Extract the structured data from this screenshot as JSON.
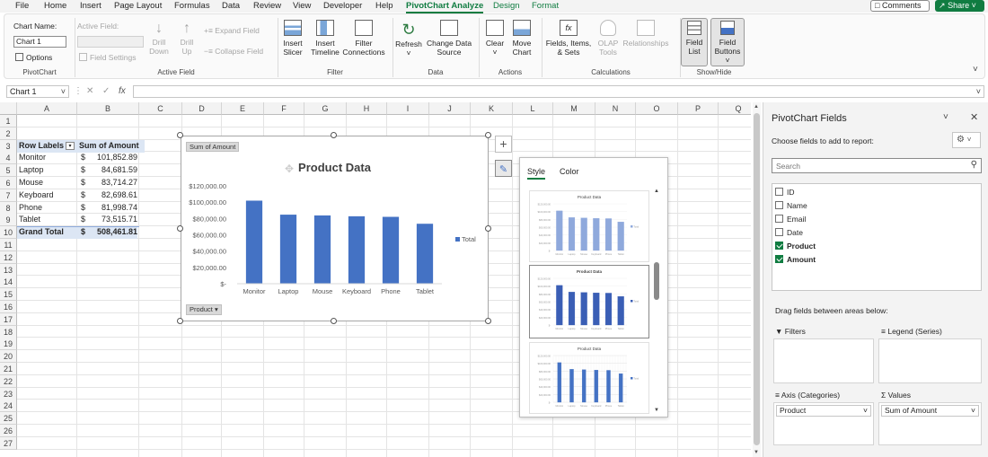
{
  "menu": {
    "tabs": [
      "File",
      "Home",
      "Insert",
      "Page Layout",
      "Formulas",
      "Data",
      "Review",
      "View",
      "Developer",
      "Help",
      "PivotChart Analyze",
      "Design",
      "Format"
    ],
    "comments": "Comments",
    "share": "Share"
  },
  "ribbon": {
    "chart_name_label": "Chart Name:",
    "chart_name_value": "Chart 1",
    "options": "Options",
    "pivotchart_group": "PivotChart",
    "active_field_label": "Active Field:",
    "field_settings": "Field Settings",
    "drill_down": [
      "Drill",
      "Down"
    ],
    "drill_up": [
      "Drill",
      "Up"
    ],
    "expand_field": "Expand Field",
    "collapse_field": "Collapse Field",
    "active_field_group": "Active Field",
    "insert_slicer": [
      "Insert",
      "Slicer"
    ],
    "insert_timeline": [
      "Insert",
      "Timeline"
    ],
    "filter_connections": [
      "Filter",
      "Connections"
    ],
    "filter_group": "Filter",
    "refresh": "Refresh",
    "change_data_source": [
      "Change Data",
      "Source"
    ],
    "data_group": "Data",
    "clear": "Clear",
    "move_chart": [
      "Move",
      "Chart"
    ],
    "actions_group": "Actions",
    "fields_items_sets": [
      "Fields, Items,",
      "& Sets"
    ],
    "olap_tools": [
      "OLAP",
      "Tools"
    ],
    "relationships": "Relationships",
    "calculations_group": "Calculations",
    "field_list": [
      "Field",
      "List"
    ],
    "field_buttons": [
      "Field",
      "Buttons"
    ],
    "showhide_group": "Show/Hide"
  },
  "formula_bar": {
    "name_box": "Chart 1",
    "fx": "fx",
    "content": ""
  },
  "sheet": {
    "columns": [
      "A",
      "B",
      "C",
      "D",
      "E",
      "F",
      "G",
      "H",
      "I",
      "J",
      "K",
      "L",
      "M",
      "N",
      "O",
      "P",
      "Q"
    ],
    "rows": [
      "1",
      "2",
      "3",
      "4",
      "5",
      "6",
      "7",
      "8",
      "9",
      "10",
      "11",
      "12",
      "13",
      "14",
      "15",
      "16",
      "17",
      "18",
      "19",
      "20",
      "21",
      "22",
      "23",
      "24",
      "25",
      "26",
      "27"
    ],
    "header": {
      "label": "Row Labels",
      "value": "Sum of Amount"
    },
    "data": [
      {
        "label": "Monitor",
        "currency": "$",
        "value": "101,852.89"
      },
      {
        "label": "Laptop",
        "currency": "$",
        "value": "84,681.59"
      },
      {
        "label": "Mouse",
        "currency": "$",
        "value": "83,714.27"
      },
      {
        "label": "Keyboard",
        "currency": "$",
        "value": "82,698.61"
      },
      {
        "label": "Phone",
        "currency": "$",
        "value": "81,998.74"
      },
      {
        "label": "Tablet",
        "currency": "$",
        "value": "73,515.71"
      }
    ],
    "total": {
      "label": "Grand Total",
      "currency": "$",
      "value": "508,461.81"
    }
  },
  "chart_data": {
    "type": "bar",
    "title": "Product Data",
    "value_button": "Sum of Amount",
    "axis_button": "Product",
    "categories": [
      "Monitor",
      "Laptop",
      "Mouse",
      "Keyboard",
      "Phone",
      "Tablet"
    ],
    "series": [
      {
        "name": "Total",
        "values": [
          101852.89,
          84681.59,
          83714.27,
          82698.61,
          81998.74,
          73515.71
        ]
      }
    ],
    "ylim": [
      0,
      120000
    ],
    "yticks": [
      "$-",
      "$20,000.00",
      "$40,000.00",
      "$60,000.00",
      "$80,000.00",
      "$100,000.00",
      "$120,000.00"
    ],
    "legend_position": "right",
    "bar_color": "#4472c4",
    "grid": false
  },
  "style_gallery": {
    "tabs": [
      "Style",
      "Color"
    ],
    "thumb_title": "Product Data"
  },
  "pane": {
    "title": "PivotChart Fields",
    "subtitle": "Choose fields to add to report:",
    "search_placeholder": "Search",
    "fields": [
      {
        "name": "ID",
        "checked": false
      },
      {
        "name": "Name",
        "checked": false
      },
      {
        "name": "Email",
        "checked": false
      },
      {
        "name": "Date",
        "checked": false
      },
      {
        "name": "Product",
        "checked": true
      },
      {
        "name": "Amount",
        "checked": true
      }
    ],
    "drag_label": "Drag fields between areas below:",
    "filters": "Filters",
    "legend": "Legend (Series)",
    "axis": "Axis (Categories)",
    "values": "Values",
    "axis_item": "Product",
    "values_item": "Sum of Amount"
  },
  "colors": {
    "accent": "#107c41",
    "bar": "#4472c4"
  }
}
